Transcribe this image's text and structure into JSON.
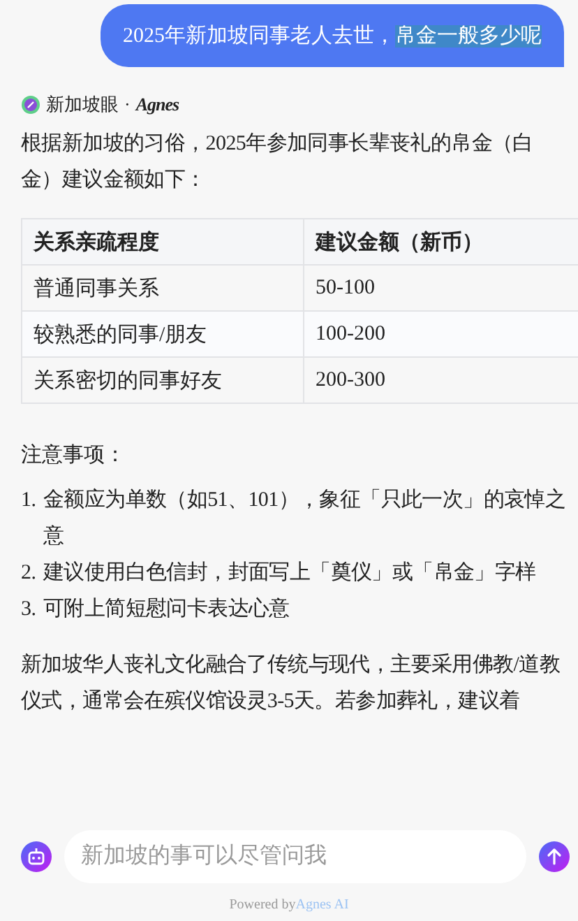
{
  "user_message": {
    "text": "2025年新加坡同事老人去世，",
    "selected_text": "帛金一般多少呢"
  },
  "source": {
    "name": "新加坡眼",
    "separator": "·",
    "brand": "Agnes"
  },
  "intro": "根据新加坡的习俗，2025年参加同事长辈丧礼的帛金（白金）建议金额如下：",
  "table": {
    "columns": [
      "关系亲疏程度",
      "建议金额（新币）"
    ],
    "rows": [
      [
        "普通同事关系",
        "50-100"
      ],
      [
        "较熟悉的同事/朋友",
        "100-200"
      ],
      [
        "关系密切的同事好友",
        "200-300"
      ]
    ]
  },
  "notes_title": "注意事项：",
  "notes": [
    {
      "number": "1.",
      "text": "金额应为单数（如51、101），象征「只此一次」的哀悼之意"
    },
    {
      "number": "2.",
      "text": "建议使用白色信封，封面写上「奠仪」或「帛金」字样"
    },
    {
      "number": "3.",
      "text": "可附上简短慰问卡表达心意"
    }
  ],
  "closing": "新加坡华人丧礼文化融合了传统与现代，主要采用佛教/道教仪式，通常会在殡仪馆设灵3-5天。若参加葬礼，建议着",
  "composer": {
    "placeholder": "新加坡的事可以尽管问我"
  },
  "footer": {
    "prefix": "Powered by",
    "link": "Agnes AI"
  }
}
